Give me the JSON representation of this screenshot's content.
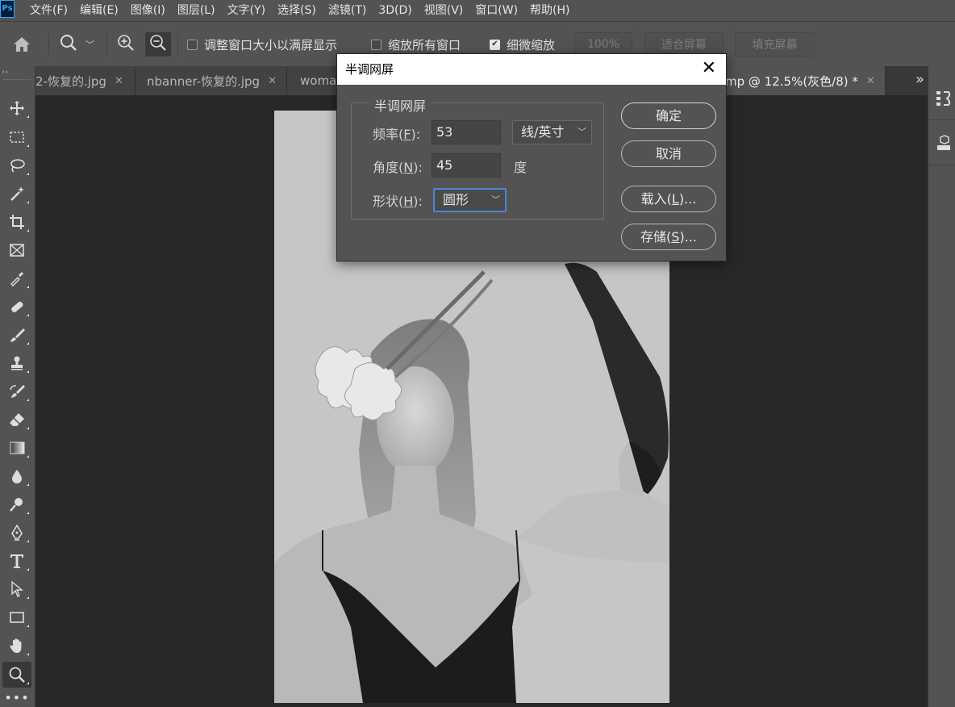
{
  "app": {
    "logo": "Ps"
  },
  "menu": [
    "文件(F)",
    "编辑(E)",
    "图像(I)",
    "图层(L)",
    "文字(Y)",
    "选择(S)",
    "滤镜(T)",
    "3D(D)",
    "视图(V)",
    "窗口(W)",
    "帮助(H)"
  ],
  "options": {
    "resize_windows_label": "调整窗口大小以满屏显示",
    "resize_windows_checked": false,
    "zoom_all_label": "缩放所有窗口",
    "zoom_all_checked": false,
    "scrubby_zoom_label": "细微缩放",
    "scrubby_zoom_checked": true,
    "zoom_100": "100%",
    "fit_screen": "适合屏幕",
    "fill_screen": "填充屏幕"
  },
  "tabs": [
    {
      "label": "2-恢复的.jpg"
    },
    {
      "label": "nbanner-恢复的.jpg"
    },
    {
      "label": "woma"
    },
    {
      "label": "mp @ 12.5%(灰色/8) *"
    }
  ],
  "tab_overflow": "»",
  "dialog": {
    "title": "半调网屏",
    "close": "✕",
    "group_title": "半调网屏",
    "frequency_label": "频率(",
    "frequency_key": "F",
    "frequency_value": "53",
    "frequency_unit": "线/英寸",
    "angle_label": "角度(",
    "angle_key": "N",
    "angle_value": "45",
    "angle_unit": "度",
    "shape_label": "形状(",
    "shape_key": "H",
    "shape_value": "圆形",
    "ok": "确定",
    "cancel": "取消",
    "load_prefix": "载入(",
    "load_key": "L",
    "load_suffix": ")...",
    "save_prefix": "存储(",
    "save_key": "S",
    "save_suffix": ")..."
  },
  "colors": {
    "chrome": "#535353",
    "workspace": "#282828",
    "focus": "#4b86d6"
  }
}
